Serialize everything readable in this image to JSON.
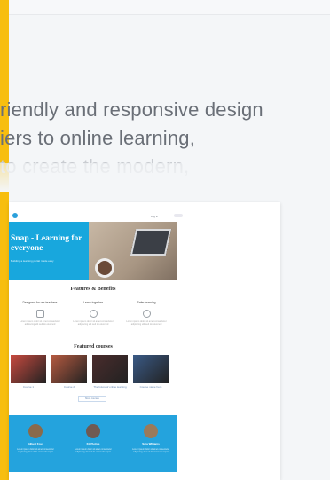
{
  "intro": {
    "lines": [
      "riendly and responsive design",
      "iers to online learning,",
      "to create the modern,"
    ]
  },
  "preview": {
    "nav_right": "Log in",
    "hero_title": "Snap - Learning for everyone",
    "hero_subtitle": "Building a learning portal made easy",
    "features_title": "Features & Benefits",
    "features": [
      {
        "name": "Designed for our teachers",
        "desc": "Lorem ipsum dolor sit amet consectetur adipiscing elit sed do eiusmod"
      },
      {
        "name": "Learn together",
        "desc": "Lorem ipsum dolor sit amet consectetur adipiscing elit sed do eiusmod"
      },
      {
        "name": "Safer learning",
        "desc": "Lorem ipsum dolor sit amet consectetur adipiscing elit sed do eiusmod"
      }
    ],
    "courses_title": "Featured courses",
    "courses": [
      {
        "label": "Course 1",
        "color": "#c84a3f"
      },
      {
        "label": "Course 2",
        "color": "#b55a40"
      },
      {
        "label": "The future of online learning",
        "color": "#4a2c2c"
      },
      {
        "label": "Course name here",
        "color": "#3a5a86"
      }
    ],
    "more_courses": "More courses",
    "testimonials": [
      {
        "name": "Gilbert Foss",
        "quote": "Lorem ipsum dolor sit amet consectetur adipiscing elit sed do eiusmod tempor"
      },
      {
        "name": "Kit Pietras",
        "quote": "Lorem ipsum dolor sit amet consectetur adipiscing elit sed do eiusmod tempor"
      },
      {
        "name": "Sara Williams",
        "quote": "Lorem ipsum dolor sit amet consectetur adipiscing elit sed do eiusmod tempor"
      }
    ]
  }
}
